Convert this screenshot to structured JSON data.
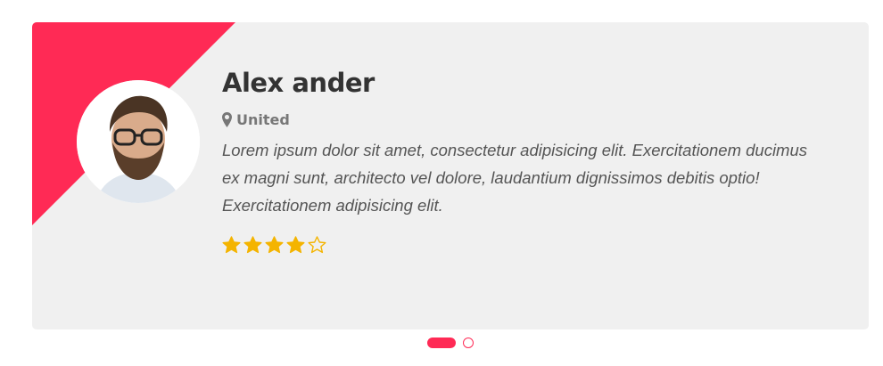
{
  "testimonial": {
    "name": "Alex ander",
    "location": "United",
    "quote": "Lorem ipsum dolor sit amet, consectetur adipisicing elit. Exercitationem ducimus ex magni sunt, architecto vel dolore, laudantium dignissimos debitis optio! Exercitationem adipisicing elit.",
    "rating": 4,
    "rating_max": 5,
    "avatar_icon": "person-avatar-icon",
    "location_icon": "map-marker-icon"
  },
  "carousel": {
    "slide_count": 2,
    "active_index": 0
  },
  "colors": {
    "accent": "#ff2a55",
    "card_background": "#f0f0f0",
    "star": "#f4b400",
    "name": "#333333",
    "location": "#777777",
    "quote": "#555555"
  }
}
